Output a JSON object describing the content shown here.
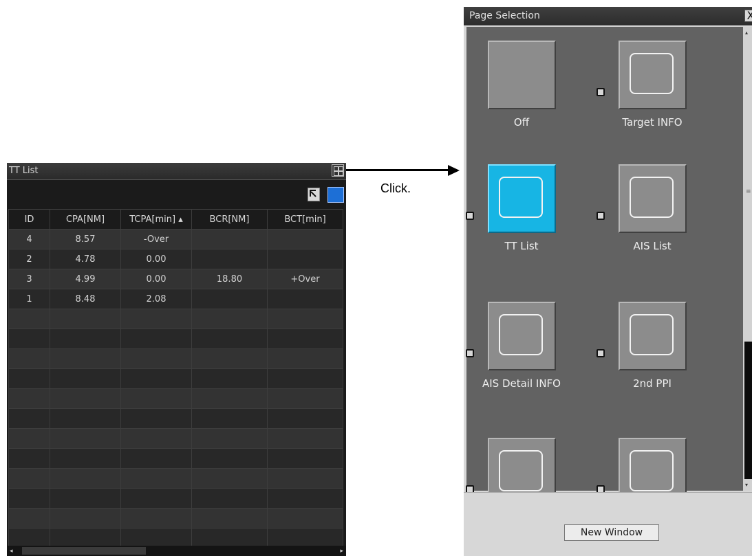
{
  "tt_list": {
    "title": "TT List",
    "columns": [
      "ID",
      "CPA[NM]",
      "TCPA[min] ▴",
      "BCR[NM]",
      "BCT[min]"
    ],
    "rows": [
      [
        "4",
        "8.57",
        "-Over",
        "",
        ""
      ],
      [
        "2",
        "4.78",
        "0.00",
        "",
        ""
      ],
      [
        "3",
        "4.99",
        "0.00",
        "18.80",
        "+Over"
      ],
      [
        "1",
        "8.48",
        "2.08",
        "",
        ""
      ],
      [
        "",
        "",
        "",
        "",
        ""
      ],
      [
        "",
        "",
        "",
        "",
        ""
      ],
      [
        "",
        "",
        "",
        "",
        ""
      ],
      [
        "",
        "",
        "",
        "",
        ""
      ],
      [
        "",
        "",
        "",
        "",
        ""
      ],
      [
        "",
        "",
        "",
        "",
        ""
      ],
      [
        "",
        "",
        "",
        "",
        ""
      ],
      [
        "",
        "",
        "",
        "",
        ""
      ],
      [
        "",
        "",
        "",
        "",
        ""
      ],
      [
        "",
        "",
        "",
        "",
        ""
      ],
      [
        "",
        "",
        "",
        "",
        ""
      ],
      [
        "",
        "",
        "",
        "",
        ""
      ]
    ],
    "icons": {
      "grid": "grid-layout-icon",
      "pin": "pin-icon",
      "mode": "blue-square-icon"
    }
  },
  "annotation": {
    "text": "Click."
  },
  "page_selection": {
    "title": "Page Selection",
    "close_label": "X",
    "items": [
      {
        "label": "Off",
        "checkbox": false,
        "state": "blank"
      },
      {
        "label": "Target INFO",
        "checkbox": true,
        "state": "normal"
      },
      {
        "label": "TT List",
        "checkbox": true,
        "state": "active"
      },
      {
        "label": "AIS List",
        "checkbox": true,
        "state": "normal"
      },
      {
        "label": "AIS Detail INFO",
        "checkbox": true,
        "state": "normal"
      },
      {
        "label": "2nd PPI",
        "checkbox": true,
        "state": "normal"
      },
      {
        "label": "",
        "checkbox": true,
        "state": "normal"
      },
      {
        "label": "",
        "checkbox": true,
        "state": "normal"
      }
    ],
    "new_window_label": "New Window"
  },
  "colors": {
    "active": "#17b5e4",
    "mode_button": "#1d6fd6"
  }
}
